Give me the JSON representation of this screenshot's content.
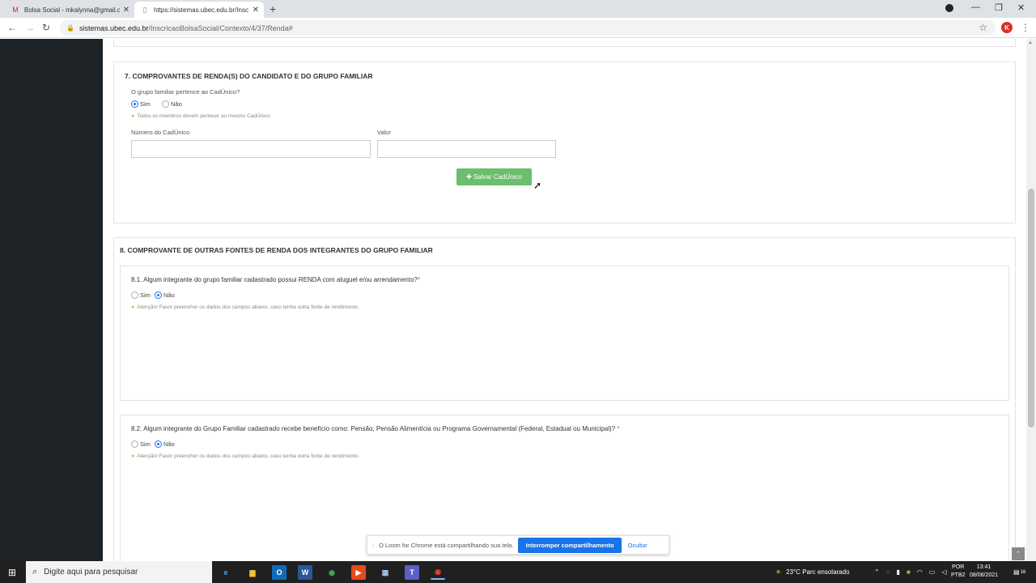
{
  "browser": {
    "tabs": [
      {
        "title": "Bolsa Social - mkalynna@gmail.c",
        "icon": "gmail-icon"
      },
      {
        "title": "https://sistemas.ubec.edu.br/Insc",
        "icon": "page-icon"
      }
    ],
    "new_tab": "+",
    "url_host": "sistemas.ubec.edu.br",
    "url_path": "/InscricaoBolsaSocial/Contexto/4/37/Renda#",
    "profile_initial": "K"
  },
  "section7": {
    "title": "7. COMPROVANTES DE RENDA(S) DO CANDIDATO E DO GRUPO FAMILIAR",
    "question": "O grupo familiar pertence ao CadÚnico?",
    "option_yes": "Sim",
    "option_no": "Não",
    "selected": "Sim",
    "hint": "Todos os membros devem pertecer ao mesmo CadÚnico.",
    "field_number_label": "Número do CadÚnico",
    "field_value_label": "Valor",
    "save_button": "Salvar CadÚnico"
  },
  "section8": {
    "title": "8. COMPROVANTE DE OUTRAS FONTES DE RENDA DOS INTEGRANTES DO GRUPO FAMILIAR",
    "q1": "8.1. Algum integrante do grupo familiar cadastrado possui RENDA com aluguel e/ou arrendamento?",
    "q1_req": "*",
    "q2": "8.2. Algum integrante do Grupo Familiar cadastrado recebe benefício como: Pensão, Pensão Alimentícia ou Programa Governamental (Federal, Estadual ou Municipal)?",
    "q2_req": " *",
    "option_yes": "Sim",
    "option_no": "Não",
    "hint": "Atenção! Favor preencher os dados dos campos abaixo, caso tenha outra fonte de rendimento."
  },
  "loom": {
    "message": "O Loom for Chrome está compartilhando sua tela.",
    "stop_button": "Interromper compartilhamento",
    "hide_link": "Ocultar"
  },
  "taskbar": {
    "search_placeholder": "Digite aqui para pesquisar",
    "weather": "23°C  Parc ensolarado",
    "lang_line1": "POR",
    "lang_line2": "PTB2",
    "time": "13:41",
    "date": "08/08/2021",
    "notif_count": "16"
  },
  "colors": {
    "accent": "#1a73e8",
    "green_button": "#5cb85c",
    "sidebar": "#1d2327",
    "hint_icon": "#f0ad4e"
  }
}
